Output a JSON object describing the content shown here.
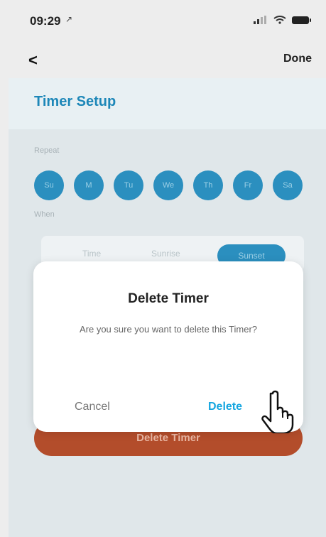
{
  "status_bar": {
    "time": "09:29",
    "location_glyph": "↗"
  },
  "nav": {
    "back_glyph": "<",
    "done_label": "Done"
  },
  "page": {
    "title": "Timer Setup"
  },
  "background": {
    "repeat_label": "Repeat",
    "days": [
      "Su",
      "M",
      "Tu",
      "We",
      "Th",
      "Fr",
      "Sa"
    ],
    "when_label": "When",
    "segment": {
      "time": "Time",
      "sunrise": "Sunrise",
      "sunset": "Sunset"
    },
    "delete_timer_label": "Delete Timer"
  },
  "dialog": {
    "title": "Delete Timer",
    "message": "Are you sure you want to delete this Timer?",
    "cancel_label": "Cancel",
    "delete_label": "Delete"
  },
  "icons": {
    "signal": "signal-icon",
    "wifi": "wifi-icon",
    "battery": "battery-icon",
    "hand": "hand-pointer-icon"
  },
  "colors": {
    "accent": "#1d87b8",
    "delete_blue": "#16a6e0",
    "danger": "#b34d2b"
  }
}
